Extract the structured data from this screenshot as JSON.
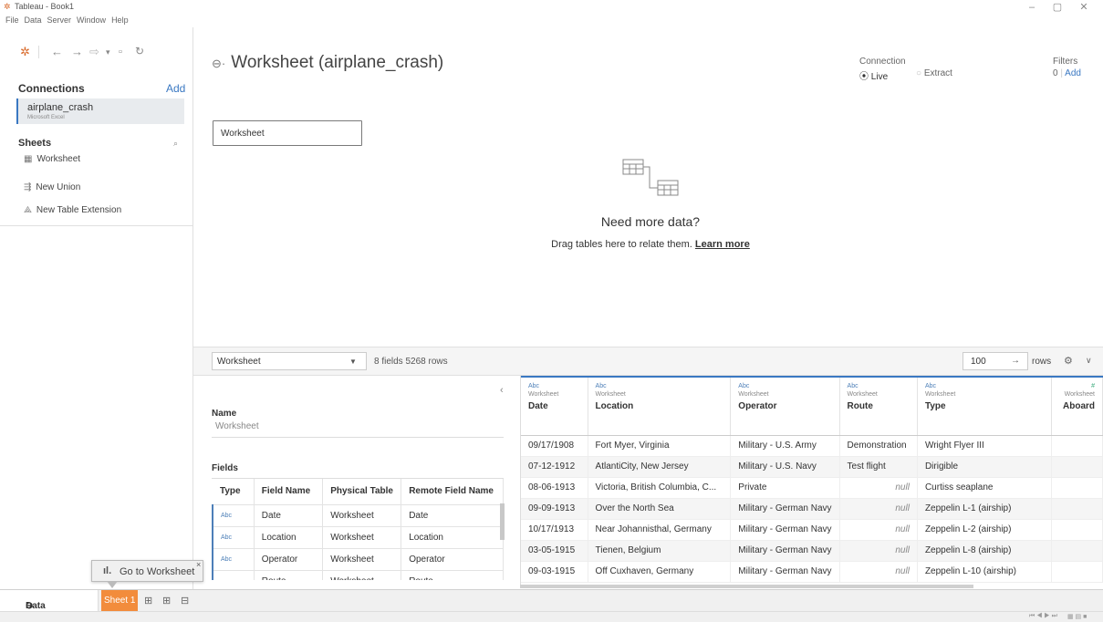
{
  "window": {
    "title": "Tableau - Book1"
  },
  "menu": [
    "File",
    "Data",
    "Server",
    "Window",
    "Help"
  ],
  "left_panel": {
    "connections_heading": "Connections",
    "add_label": "Add",
    "connection_name": "airplane_crash",
    "connection_type": "Microsoft Excel",
    "sheets_heading": "Sheets",
    "sheet_item": "Worksheet",
    "new_union": "New Union",
    "new_table_extension": "New Table Extension"
  },
  "canvas": {
    "title": "Worksheet (airplane_crash)",
    "connection_label": "Connection",
    "live_label": "Live",
    "extract_label": "Extract",
    "filters_label": "Filters",
    "filters_count": "0",
    "filters_add": "Add",
    "table_box": "Worksheet",
    "need_more": "Need more data?",
    "drag_text": "Drag tables here to relate them.",
    "learn_more": "Learn more"
  },
  "mid_bar": {
    "table_select": "Worksheet",
    "fields_info": "8 fields 5268 rows",
    "rows_value": "100",
    "rows_label": "rows"
  },
  "metadata": {
    "name_heading": "Name",
    "name_value": "Worksheet",
    "fields_heading": "Fields",
    "columns": [
      "Type",
      "Field Name",
      "Physical Table",
      "Remote Field Name"
    ],
    "rows": [
      {
        "type": "Abc",
        "field": "Date",
        "table": "Worksheet",
        "remote": "Date"
      },
      {
        "type": "Abc",
        "field": "Location",
        "table": "Worksheet",
        "remote": "Location"
      },
      {
        "type": "Abc",
        "field": "Operator",
        "table": "Worksheet",
        "remote": "Operator"
      },
      {
        "type": "",
        "field": "Route",
        "table": "Worksheet",
        "remote": "Route"
      }
    ]
  },
  "grid": {
    "columns": [
      {
        "type": "Abc",
        "table": "Worksheet",
        "name": "Date"
      },
      {
        "type": "Abc",
        "table": "Worksheet",
        "name": "Location"
      },
      {
        "type": "Abc",
        "table": "Worksheet",
        "name": "Operator"
      },
      {
        "type": "Abc",
        "table": "Worksheet",
        "name": "Route"
      },
      {
        "type": "Abc",
        "table": "Worksheet",
        "name": "Type"
      },
      {
        "type": "#",
        "table": "Worksheet",
        "name": "Aboard"
      }
    ],
    "rows": [
      [
        "09/17/1908",
        "Fort Myer, Virginia",
        "Military - U.S. Army",
        "Demonstration",
        "Wright Flyer III",
        ""
      ],
      [
        "07-12-1912",
        "AtlantiCity, New Jersey",
        "Military - U.S. Navy",
        "Test flight",
        "Dirigible",
        ""
      ],
      [
        "08-06-1913",
        "Victoria, British Columbia, C...",
        "Private",
        "null",
        "Curtiss seaplane",
        ""
      ],
      [
        "09-09-1913",
        "Over the North Sea",
        "Military - German Navy",
        "null",
        "Zeppelin L-1 (airship)",
        ""
      ],
      [
        "10/17/1913",
        "Near Johannisthal, Germany",
        "Military - German Navy",
        "null",
        "Zeppelin L-2 (airship)",
        ""
      ],
      [
        "03-05-1915",
        "Tienen, Belgium",
        "Military - German Navy",
        "null",
        "Zeppelin L-8 (airship)",
        ""
      ],
      [
        "09-03-1915",
        "Off Cuxhaven, Germany",
        "Military - German Navy",
        "null",
        "Zeppelin L-10 (airship)",
        ""
      ]
    ]
  },
  "tooltip": {
    "text": "Go to Worksheet"
  },
  "bottom": {
    "data_source": "Data Source",
    "sheet1": "Sheet 1"
  },
  "colors": {
    "accent": "#3a78c2",
    "sheet_tab": "#f28c3c"
  }
}
